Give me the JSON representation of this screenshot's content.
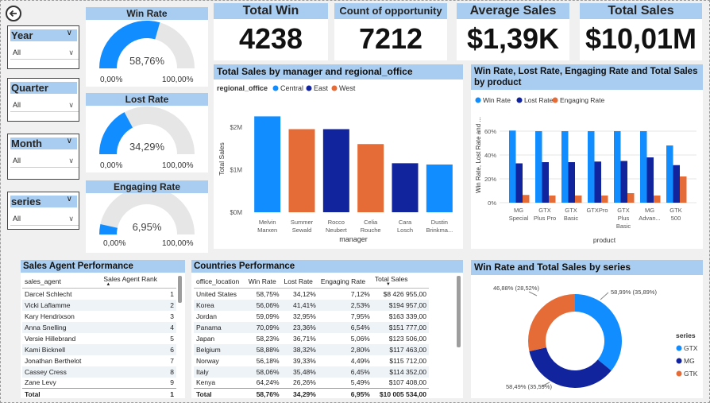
{
  "slicers": [
    {
      "title": "Year",
      "value": "All"
    },
    {
      "title": "Quarter",
      "value": "All"
    },
    {
      "title": "Month",
      "value": "All"
    },
    {
      "title": "series",
      "value": "All"
    }
  ],
  "gauges": [
    {
      "title": "Win Rate",
      "value_text": "58,76%",
      "fraction": 0.5876,
      "min": "0,00%",
      "max": "100,00%"
    },
    {
      "title": "Lost Rate",
      "value_text": "34,29%",
      "fraction": 0.3429,
      "min": "0,00%",
      "max": "100,00%"
    },
    {
      "title": "Engaging Rate",
      "value_text": "6,95%",
      "fraction": 0.0695,
      "min": "0,00%",
      "max": "100,00%"
    }
  ],
  "kpis": [
    {
      "title": "Total Win",
      "value": "4238"
    },
    {
      "title": "Count of opportunity",
      "value": "7212"
    },
    {
      "title": "Average Sales",
      "value": "$1,39K"
    },
    {
      "title": "Total Sales",
      "value": "$10,01M"
    }
  ],
  "colors": {
    "central": "#118dff",
    "east": "#12239e",
    "west": "#e66c37",
    "header": "#a9cdf0"
  },
  "bar_chart": {
    "title": "Total Sales by manager and regional_office",
    "legend_title": "regional_office",
    "legend": [
      "Central",
      "East",
      "West"
    ],
    "ylabel": "Total Sales",
    "xlabel": "manager",
    "ticks": [
      "$2M",
      "$1M",
      "$0M"
    ],
    "categories": [
      [
        "Melvin",
        "Marxen"
      ],
      [
        "Summer",
        "Sewald"
      ],
      [
        "Rocco",
        "Neubert"
      ],
      [
        "Celia",
        "Rouche"
      ],
      [
        "Cara",
        "Losch"
      ],
      [
        "Dustin",
        "Brinkma..."
      ]
    ]
  },
  "rate_chart": {
    "title": "Win Rate, Lost Rate, Engaging Rate and Total Sales by product",
    "legend": [
      "Win Rate",
      "Lost Rate",
      "Engaging Rate"
    ],
    "ylabel": "Win Rate, Lost Rate and ...",
    "xlabel": "product",
    "ticks": [
      "60%",
      "40%",
      "20%",
      "0%"
    ],
    "categories": [
      [
        "MG",
        "Special"
      ],
      [
        "GTX",
        "Plus Pro"
      ],
      [
        "GTX",
        "Basic"
      ],
      [
        "GTXPro"
      ],
      [
        "GTX",
        "Plus",
        "Basic"
      ],
      [
        "MG",
        "Advan..."
      ],
      [
        "GTK",
        "500"
      ]
    ]
  },
  "chart_data": [
    {
      "type": "bar",
      "title": "Total Sales by manager and regional_office",
      "xlabel": "manager",
      "ylabel": "Total Sales",
      "categories": [
        "Melvin Marxen",
        "Summer Sewald",
        "Rocco Neubert",
        "Celia Rouche",
        "Cara Losch",
        "Dustin Brinkma..."
      ],
      "values": [
        2250000,
        1950000,
        1950000,
        1600000,
        1150000,
        1120000
      ],
      "series_by_bar": [
        "Central",
        "West",
        "East",
        "West",
        "East",
        "Central"
      ],
      "ylim": [
        0,
        2500000
      ],
      "legend": "top-left"
    },
    {
      "type": "bar",
      "title": "Win Rate, Lost Rate, Engaging Rate and Total Sales by product",
      "xlabel": "product",
      "ylabel": "Win Rate, Lost Rate and ...",
      "categories": [
        "MG Special",
        "GTX Plus Pro",
        "GTX Basic",
        "GTXPro",
        "GTX Plus Basic",
        "MG Advan...",
        "GTK 500"
      ],
      "series": [
        {
          "name": "Win Rate",
          "values": [
            60.5,
            60.0,
            60.0,
            60.0,
            60.0,
            60.0,
            48.0
          ]
        },
        {
          "name": "Lost Rate",
          "values": [
            33.0,
            34.0,
            34.0,
            34.5,
            35.0,
            38.0,
            31.5
          ]
        },
        {
          "name": "Engaging Rate",
          "values": [
            6.5,
            6.0,
            6.0,
            6.0,
            8.0,
            6.0,
            22.0
          ]
        }
      ],
      "ylim": [
        0,
        70
      ],
      "legend": "top-left"
    },
    {
      "type": "pie",
      "title": "Win Rate and Total Sales by series",
      "legend_title": "series",
      "legend": [
        "GTX",
        "MG",
        "GTK"
      ],
      "labels": [
        "58,99% (35,89%)",
        "58,49% (35,59%)",
        "46,88% (28,52%)"
      ],
      "shares": [
        35.89,
        35.59,
        28.52
      ]
    }
  ],
  "agents_table": {
    "title": "Sales Agent Performance",
    "headers": [
      "sales_agent",
      "Sales Agent Rank"
    ],
    "rows": [
      [
        "Darcel Schlecht",
        "1"
      ],
      [
        "Vicki Laflamme",
        "2"
      ],
      [
        "Kary Hendrixson",
        "3"
      ],
      [
        "Anna Snelling",
        "4"
      ],
      [
        "Versie Hillebrand",
        "5"
      ],
      [
        "Kami Bicknell",
        "6"
      ],
      [
        "Jonathan Berthelot",
        "7"
      ],
      [
        "Cassey Cress",
        "8"
      ],
      [
        "Zane Levy",
        "9"
      ]
    ],
    "total": [
      "Total",
      "1"
    ]
  },
  "countries_table": {
    "title": "Countries Performance",
    "headers": [
      "office_location",
      "Win Rate",
      "Lost Rate",
      "Engaging Rate",
      "Total Sales"
    ],
    "rows": [
      [
        "United States",
        "58,75%",
        "34,12%",
        "7,12%",
        "$8 426 955,00"
      ],
      [
        "Korea",
        "56,06%",
        "41,41%",
        "2,53%",
        "$194 957,00"
      ],
      [
        "Jordan",
        "59,09%",
        "32,95%",
        "7,95%",
        "$163 339,00"
      ],
      [
        "Panama",
        "70,09%",
        "23,36%",
        "6,54%",
        "$151 777,00"
      ],
      [
        "Japan",
        "58,23%",
        "36,71%",
        "5,06%",
        "$123 506,00"
      ],
      [
        "Belgium",
        "58,88%",
        "38,32%",
        "2,80%",
        "$117 463,00"
      ],
      [
        "Norway",
        "56,18%",
        "39,33%",
        "4,49%",
        "$115 712,00"
      ],
      [
        "Italy",
        "58,06%",
        "35,48%",
        "6,45%",
        "$114 352,00"
      ],
      [
        "Kenya",
        "64,24%",
        "26,26%",
        "5,49%",
        "$107 408,00"
      ]
    ],
    "total": [
      "Total",
      "58,76%",
      "34,29%",
      "6,95%",
      "$10 005 534,00"
    ]
  },
  "donut": {
    "title": "Win Rate and Total Sales by series",
    "legend_title": "series",
    "legend": [
      "GTX",
      "MG",
      "GTK"
    ],
    "labels": [
      "58,99% (35,89%)",
      "58,49% (35,59%)",
      "46,88% (28,52%)"
    ]
  }
}
